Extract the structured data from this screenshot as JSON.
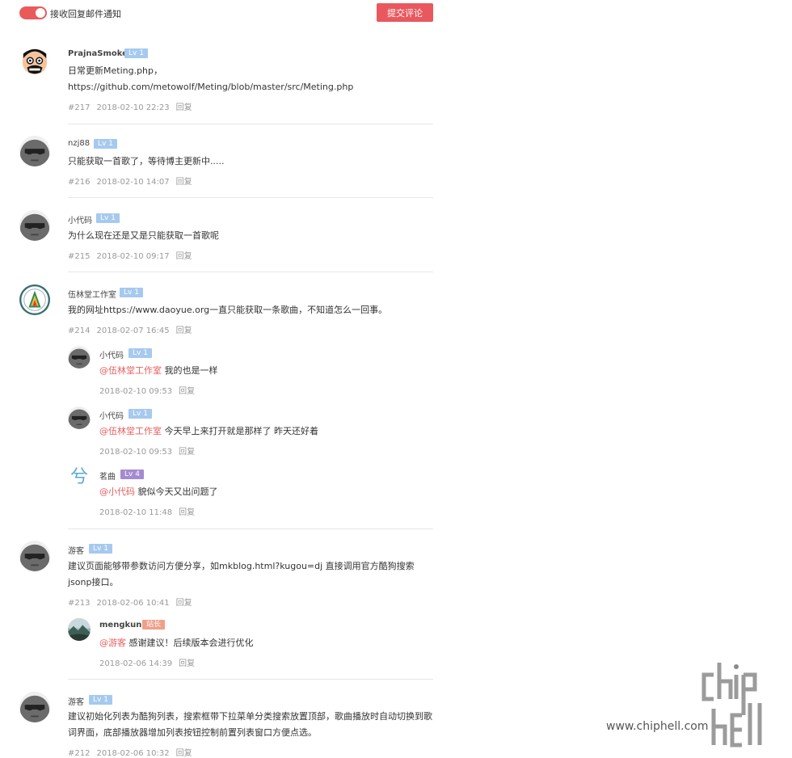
{
  "header": {
    "toggle_label": "接收回复邮件通知",
    "submit_label": "提交评论"
  },
  "colors": {
    "accent": "#e9585e",
    "lv1": "#a6c9ef",
    "lv4": "#a48bd1",
    "host": "#f0a08a"
  },
  "comments": [
    {
      "name": "PrajnaSmoke",
      "level": "Lv 1",
      "line1": "日常更新Meting.php，",
      "line2": "https://github.com/metowolf/Meting/blob/master/src/Meting.php",
      "num": "#217",
      "time": "2018-02-10 22:23",
      "reply": "回复",
      "avatar": "cartoon-face"
    },
    {
      "name": "nzj88",
      "level": "Lv 1",
      "line1": "只能获取一首歌了，等待博主更新中.....",
      "num": "#216",
      "time": "2018-02-10 14:07",
      "reply": "回复",
      "avatar": "sunglasses-default"
    },
    {
      "name": "小代码",
      "level": "Lv 1",
      "line1": "为什么现在还是又是只能获取一首歌呢",
      "num": "#215",
      "time": "2018-02-10 09:17",
      "reply": "回复",
      "avatar": "sunglasses-default"
    },
    {
      "name": "伍林堂工作室",
      "level": "Lv 1",
      "line1": "我的网址https://www.daoyue.org一直只能获取一条歌曲，不知道怎么一回事。",
      "num": "#214",
      "time": "2018-02-07 16:45",
      "reply": "回复",
      "avatar": "studio-logo",
      "replies": [
        {
          "name": "小代码",
          "level": "Lv 1",
          "mention": "@伍林堂工作室",
          "text": " 我的也是一样",
          "time": "2018-02-10 09:53",
          "reply": "回复"
        },
        {
          "name": "小代码",
          "level": "Lv 1",
          "mention": "@伍林堂工作室",
          "text": " 今天早上来打开就是那样了 昨天还好着",
          "time": "2018-02-10 09:53",
          "reply": "回复"
        },
        {
          "name": "茗曲",
          "level": "Lv 4",
          "mention": "@小代码",
          "text": " 貌似今天又出问题了",
          "time": "2018-02-10 11:48",
          "reply": "回复",
          "avatar_char": "兮"
        }
      ]
    },
    {
      "name": "游客",
      "level": "Lv 1",
      "line1": "建议页面能够带参数访问方便分享，如mkblog.html?kugou=dj 直接调用官方酷狗搜索",
      "line2": "jsonp接口。",
      "num": "#213",
      "time": "2018-02-06 10:41",
      "reply": "回复",
      "avatar": "sunglasses-default",
      "replies": [
        {
          "name": "mengkun",
          "level": "站长",
          "mention": "@游客",
          "text": " 感谢建议！后续版本会进行优化",
          "time": "2018-02-06 14:39",
          "reply": "回复"
        }
      ]
    },
    {
      "name": "游客",
      "level": "Lv 1",
      "line1": "建议初始化列表为酷狗列表，搜索框带下拉菜单分类搜索放置顶部，歌曲播放时自动切换到歌",
      "line2": "词界面，底部播放器增加列表按钮控制前置列表窗口方便点选。",
      "num": "#212",
      "time": "2018-02-06 10:32",
      "reply": "回复",
      "avatar": "sunglasses-default"
    }
  ],
  "watermark": {
    "text": "www.chiphell.com",
    "logo": "chip hell"
  }
}
